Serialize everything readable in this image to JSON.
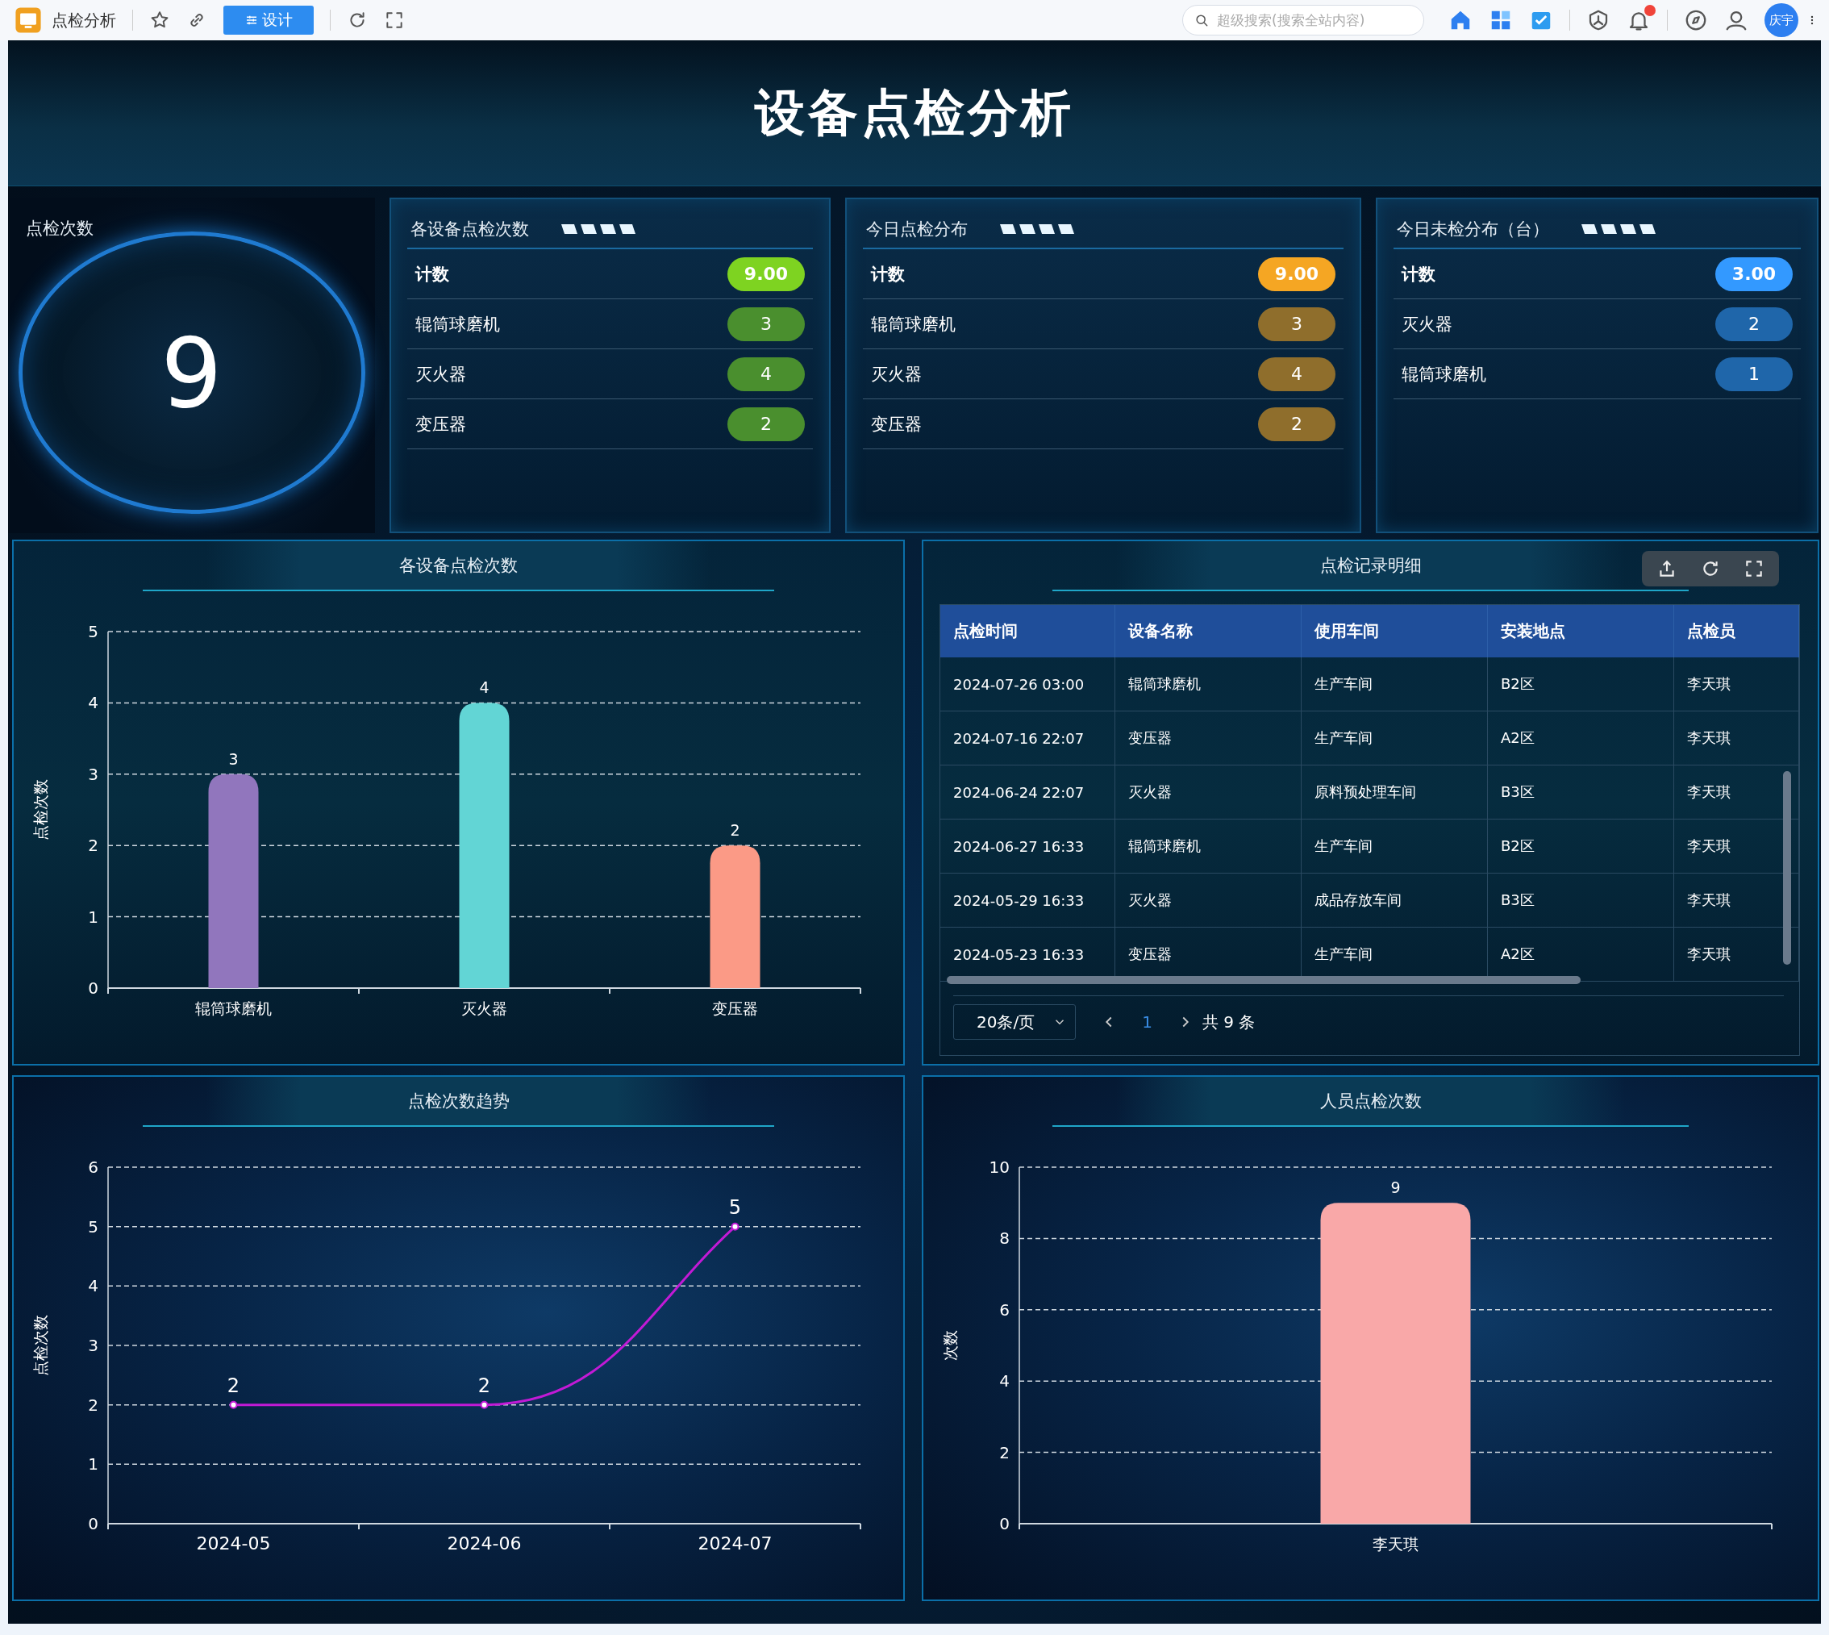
{
  "top_bar": {
    "app_title": "点检分析",
    "design_button": "设计",
    "search": {
      "placeholder": "超级搜索(搜索全站内容)"
    },
    "avatar_label": "庆宇"
  },
  "title": "设备点检分析",
  "counter": {
    "label": "点检次数",
    "value": "9"
  },
  "stat_cards": [
    {
      "title": "各设备点检次数",
      "rows": [
        {
          "kind": "total",
          "label": "计数",
          "value": "9.00",
          "color": "#7ed321"
        },
        {
          "kind": "item",
          "label": "辊筒球磨机",
          "value": "3",
          "color": "#4a8f2e"
        },
        {
          "kind": "item",
          "label": "灭火器",
          "value": "4",
          "color": "#4a8f2e"
        },
        {
          "kind": "item",
          "label": "变压器",
          "value": "2",
          "color": "#4a8f2e"
        }
      ]
    },
    {
      "title": "今日点检分布",
      "rows": [
        {
          "kind": "total",
          "label": "计数",
          "value": "9.00",
          "color": "#f5a623"
        },
        {
          "kind": "item",
          "label": "辊筒球磨机",
          "value": "3",
          "color": "#8f6e2c"
        },
        {
          "kind": "item",
          "label": "灭火器",
          "value": "4",
          "color": "#8f6e2c"
        },
        {
          "kind": "item",
          "label": "变压器",
          "value": "2",
          "color": "#8f6e2c"
        }
      ]
    },
    {
      "title": "今日未检分布（台）",
      "rows": [
        {
          "kind": "total",
          "label": "计数",
          "value": "3.00",
          "color": "#3399ff"
        },
        {
          "kind": "item",
          "label": "灭火器",
          "value": "2",
          "color": "#1f66aa"
        },
        {
          "kind": "item",
          "label": "辊筒球磨机",
          "value": "1",
          "color": "#1f66aa"
        }
      ]
    }
  ],
  "panels": [
    {
      "kind": "chart",
      "title": "各设备点检次数",
      "chart_data": {
        "type": "bar",
        "ylabel": "点检次数",
        "categories": [
          "辊筒球磨机",
          "灭火器",
          "变压器"
        ],
        "series": [
          {
            "values": [
              3,
              4,
              2
            ],
            "colors": [
              "#9176bd",
              "#62d5d5",
              "#fb9a86"
            ]
          }
        ],
        "grid": true,
        "ylim": [
          0,
          5
        ],
        "yticks": [
          0,
          1,
          2,
          3,
          4,
          5
        ],
        "data_labels": true
      }
    },
    {
      "kind": "table",
      "title": "点检记录明细",
      "table": {
        "columns": [
          "点检时间",
          "设备名称",
          "使用车间",
          "安装地点",
          "点检员"
        ],
        "rows": [
          [
            "2024-07-26 03:00",
            "辊筒球磨机",
            "生产车间",
            "B2区",
            "李天琪"
          ],
          [
            "2024-07-16 22:07",
            "变压器",
            "生产车间",
            "A2区",
            "李天琪"
          ],
          [
            "2024-06-24 22:07",
            "灭火器",
            "原料预处理车间",
            "B3区",
            "李天琪"
          ],
          [
            "2024-06-27 16:33",
            "辊筒球磨机",
            "生产车间",
            "B2区",
            "李天琪"
          ],
          [
            "2024-05-29 16:33",
            "灭火器",
            "成品存放车间",
            "B3区",
            "李天琪"
          ],
          [
            "2024-05-23 16:33",
            "变压器",
            "生产车间",
            "A2区",
            "李天琪"
          ]
        ]
      },
      "pagination": {
        "page_size": "20条/页",
        "pages": [
          {
            "label": "1",
            "selected": true
          }
        ],
        "total": "共 9 条"
      }
    },
    {
      "kind": "chart",
      "title": "点检次数趋势",
      "chart_data": {
        "type": "line",
        "ylabel": "点检次数",
        "categories": [
          "2024-05",
          "2024-06",
          "2024-07"
        ],
        "series": [
          {
            "color": "#c21ad6",
            "values": [
              2,
              2,
              5
            ],
            "marker": true
          }
        ],
        "grid": true,
        "ylim": [
          0,
          6
        ],
        "yticks": [
          0,
          1,
          2,
          3,
          4,
          5,
          6
        ],
        "data_labels": true
      }
    },
    {
      "kind": "chart",
      "title": "人员点检次数",
      "chart_data": {
        "type": "bar",
        "ylabel": "次数",
        "categories": [
          "李天琪"
        ],
        "series": [
          {
            "values": [
              9
            ],
            "colors": [
              "#f9a8a8"
            ]
          }
        ],
        "grid": true,
        "ylim": [
          0,
          10
        ],
        "yticks": [
          0,
          2,
          4,
          6,
          8,
          10
        ],
        "data_labels": true
      }
    }
  ]
}
